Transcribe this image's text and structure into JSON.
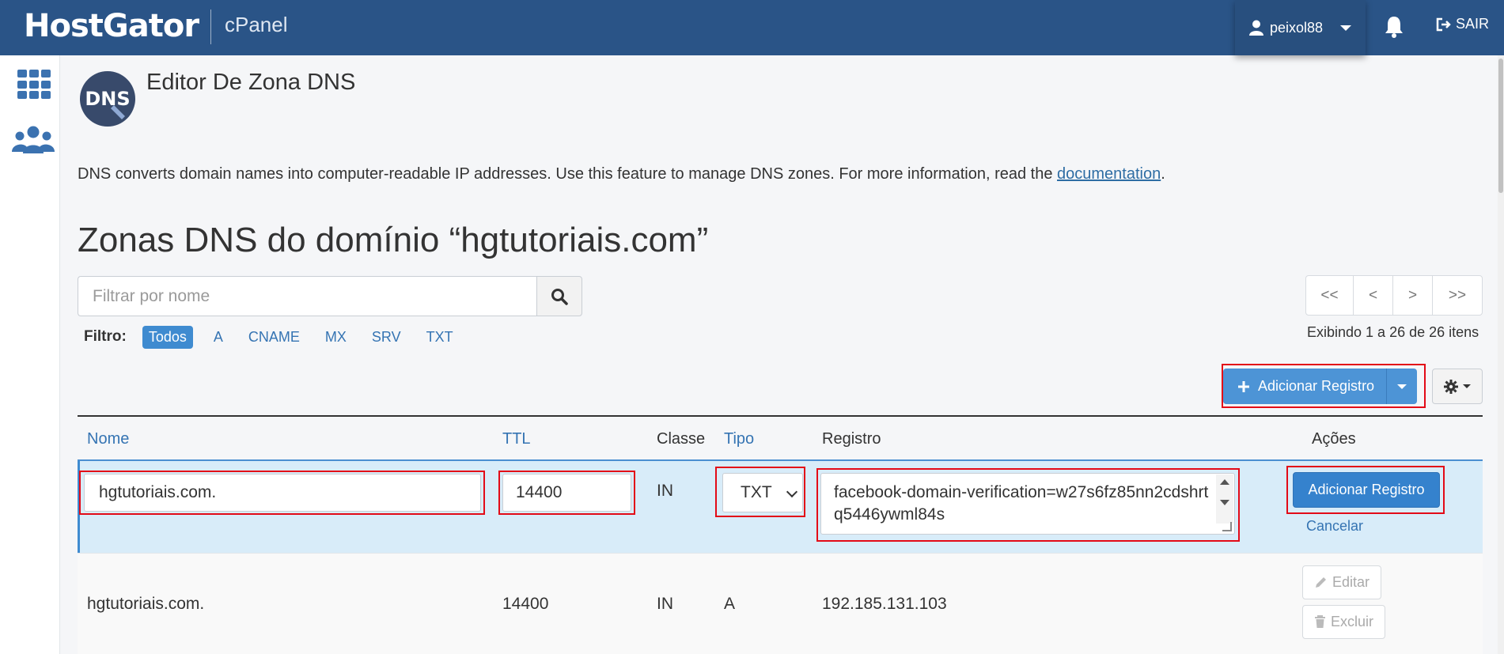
{
  "topbar": {
    "brand": "HostGator",
    "product": "cPanel",
    "username": "peixol88",
    "logout_label": "SAIR"
  },
  "icons": {
    "apps": "grid-icon",
    "users": "users-icon",
    "user": "user-icon",
    "bell": "bell-icon",
    "logout": "logout-icon",
    "search": "search-icon",
    "plus": "plus-icon",
    "gear": "gear-icon",
    "pencil": "pencil-icon",
    "trash": "trash-icon"
  },
  "page": {
    "logo_text": "DNS",
    "title": "Editor De Zona DNS",
    "intro_text": "DNS converts domain names into computer-readable IP addresses. Use this feature to manage DNS zones. For more information, read the ",
    "intro_link": "documentation",
    "intro_end": ".",
    "zone_heading": "Zonas DNS do domínio “hgtutoriais.com”"
  },
  "search": {
    "placeholder": "Filtrar por nome"
  },
  "filters": {
    "label": "Filtro:",
    "items": [
      "Todos",
      "A",
      "CNAME",
      "MX",
      "SRV",
      "TXT"
    ],
    "active": "Todos"
  },
  "pagination": {
    "first": "<<",
    "prev": "<",
    "next": ">",
    "last": ">>",
    "summary": "Exibindo 1 a 26 de 26 itens"
  },
  "toolbar": {
    "add_label": "Adicionar Registro"
  },
  "table": {
    "headers": {
      "name": "Nome",
      "ttl": "TTL",
      "class": "Classe",
      "type": "Tipo",
      "record": "Registro",
      "actions": "Ações"
    },
    "edit_row": {
      "name": "hgtutoriais.com.",
      "ttl": "14400",
      "class": "IN",
      "type": "TXT",
      "record": "facebook-domain-verification=w27s6fz85nn2cdshrtq5446ywml84s",
      "submit_label": "Adicionar Registro",
      "cancel_label": "Cancelar"
    },
    "rows": [
      {
        "name": "hgtutoriais.com.",
        "ttl": "14400",
        "class": "IN",
        "type": "A",
        "record": "192.185.131.103",
        "edit_label": "Editar",
        "delete_label": "Excluir"
      }
    ]
  },
  "colors": {
    "topbar": "#2a5487",
    "accent": "#3582cd",
    "highlight": "#e30a17",
    "link": "#3574b3"
  }
}
